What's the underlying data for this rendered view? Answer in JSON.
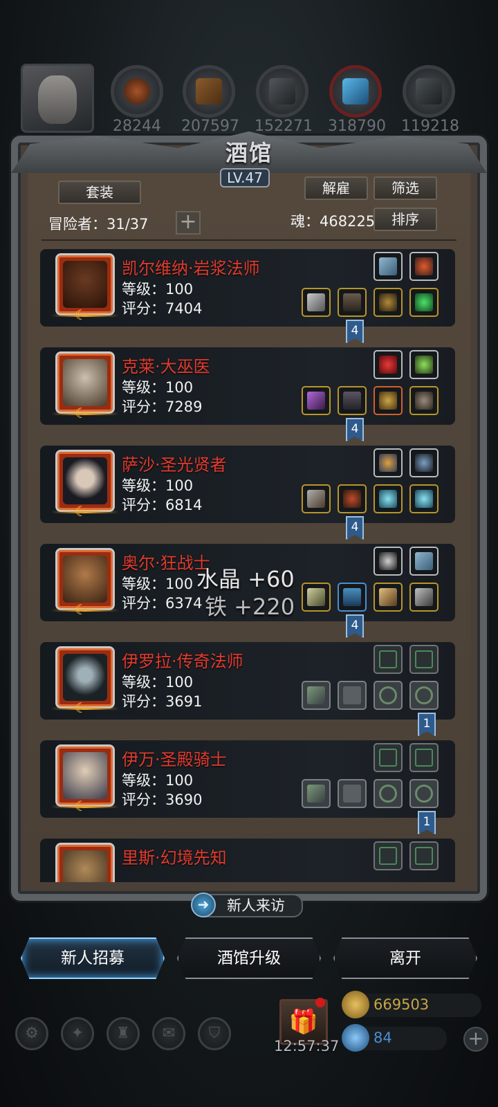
{
  "resources": [
    {
      "icon": "elf-portrait-icon",
      "value": ""
    },
    {
      "icon": "leather-icon",
      "value": "28244"
    },
    {
      "icon": "wood-plank-icon",
      "value": "207597"
    },
    {
      "icon": "stone-icon",
      "value": "152271"
    },
    {
      "icon": "crystal-icon",
      "value": "318790"
    },
    {
      "icon": "iron-ingot-icon",
      "value": "119218"
    }
  ],
  "header": {
    "title": "酒馆",
    "level": "LV.47"
  },
  "toolbar": {
    "suit_label": "套装",
    "dismiss_label": "解雇",
    "filter_label": "筛选",
    "sort_label": "排序",
    "adventurers_label": "冒险者：31/37",
    "soul_label": "魂：468225",
    "plus": "+"
  },
  "heroes": [
    {
      "name": "凯尔维纳·岩浆法师",
      "level": "等级：100",
      "score": "评分：7404",
      "tag": "4",
      "skin": "#6a3a22"
    },
    {
      "name": "克莱·大巫医",
      "level": "等级：100",
      "score": "评分：7289",
      "tag": "4",
      "skin": "#a89a88"
    },
    {
      "name": "萨沙·圣光贤者",
      "level": "等级：100",
      "score": "评分：6814",
      "tag": "4",
      "skin": "#c9b7a6"
    },
    {
      "name": "奥尔·狂战士",
      "level": "等级：100",
      "score": "评分：6374",
      "tag": "4",
      "skin": "#8a5a3a"
    },
    {
      "name": "伊罗拉·传奇法师",
      "level": "等级：100",
      "score": "评分：3691",
      "tag": "1",
      "skin": "#7f8e9a"
    },
    {
      "name": "伊万·圣殿骑士",
      "level": "等级：100",
      "score": "评分：3690",
      "tag": "1",
      "skin": "#d8c4ae"
    },
    {
      "name": "里斯·幻境先知",
      "level": "",
      "score": "",
      "tag": "",
      "skin": "#8a6a4a"
    }
  ],
  "reward_popup": {
    "line1": "水晶 +60",
    "line2": "铁 +220"
  },
  "bottom": {
    "visit_label": "新人来访",
    "recruit_label": "新人招募",
    "upgrade_label": "酒馆升级",
    "leave_label": "离开",
    "timer": "12:57:37",
    "gold": "669503",
    "gems": "84",
    "colors": {
      "gold": "#c9a646",
      "gem": "#4a8fd4"
    }
  }
}
